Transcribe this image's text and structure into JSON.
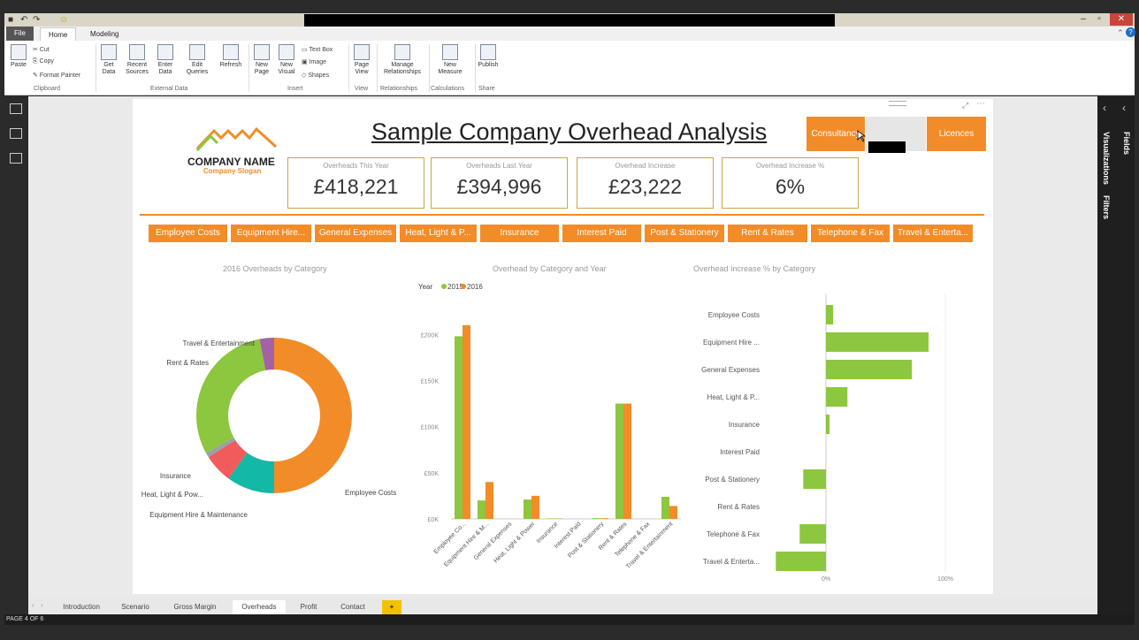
{
  "ribbon": {
    "tabs": [
      "File",
      "Home",
      "Modeling"
    ],
    "clipboard": {
      "paste": "Paste",
      "cut": "Cut",
      "copy": "Copy",
      "format_painter": "Format Painter",
      "group": "Clipboard"
    },
    "external": {
      "get_data": "Get Data",
      "recent": "Recent Sources",
      "enter": "Enter Data",
      "edit": "Edit Queries",
      "refresh": "Refresh",
      "group": "External Data"
    },
    "insert": {
      "new_page": "New Page",
      "new_visual": "New Visual",
      "text_box": "Text Box",
      "image": "Image",
      "shapes": "Shapes",
      "group": "Insert"
    },
    "view": {
      "page_view": "Page View",
      "group": "View"
    },
    "relationships": {
      "manage": "Manage Relationships",
      "group": "Relationships"
    },
    "calculations": {
      "new_measure": "New Measure",
      "group": "Calculations"
    },
    "share": {
      "publish": "Publish",
      "group": "Share"
    }
  },
  "report": {
    "title": "Sample Company Overhead Analysis",
    "company_name": "COMPANY NAME",
    "company_slogan": "Company Slogan",
    "top_slicers": [
      "Consultancy",
      "Licences"
    ],
    "kpis": [
      {
        "label": "Overheads This Year",
        "value": "£418,221"
      },
      {
        "label": "Overheads Last Year",
        "value": "£394,996"
      },
      {
        "label": "Overhead Increase",
        "value": "£23,222"
      },
      {
        "label": "Overhead Increase %",
        "value": "6%"
      }
    ],
    "category_slicers": [
      "Employee Costs",
      "Equipment Hire...",
      "General Expenses",
      "Heat, Light & P...",
      "Insurance",
      "Interest Paid",
      "Post & Stationery",
      "Rent & Rates",
      "Telephone & Fax",
      "Travel & Enterta..."
    ]
  },
  "chart_data": [
    {
      "type": "pie",
      "title": "2016 Overheads by Category",
      "categories": [
        "Employee Costs",
        "Equipment Hire & Maintenance",
        "Heat, Light & Pow...",
        "Insurance",
        "Rent & Rates",
        "Travel & Entertainment"
      ],
      "values": [
        50,
        10,
        6,
        1,
        30,
        3
      ],
      "colors": [
        "#f28c28",
        "#14b8a6",
        "#f15b5b",
        "#9aa0a6",
        "#8dc63f",
        "#a262a3"
      ]
    },
    {
      "type": "bar",
      "title": "Overhead by Category and Year",
      "legend_title": "Year",
      "categories": [
        "Employee Co...",
        "Equipment Hire & M...",
        "General Expenses",
        "Heat, Light & Power",
        "Insurance",
        "Interest Paid",
        "Post & Stationery",
        "Rent & Rates",
        "Telephone & Fax",
        "Travel & Entertainment"
      ],
      "series": [
        {
          "name": "2015",
          "color": "#8dc63f",
          "values": [
            198000,
            20000,
            0,
            21000,
            500,
            0,
            800,
            125000,
            0,
            24000
          ]
        },
        {
          "name": "2016",
          "color": "#f28c28",
          "values": [
            210000,
            40000,
            0,
            25000,
            500,
            0,
            800,
            125000,
            0,
            14000
          ]
        }
      ],
      "yticks": [
        "£0K",
        "£50K",
        "£100K",
        "£150K",
        "£200K"
      ],
      "ylim": [
        0,
        230000
      ]
    },
    {
      "type": "bar",
      "title": "Overhead Increase % by Category",
      "categories": [
        "Employee Costs",
        "Equipment Hire ...",
        "General Expenses",
        "Heat, Light & P...",
        "Insurance",
        "Interest Paid",
        "Post & Stationery",
        "Rent & Rates",
        "Telephone & Fax",
        "Travel & Enterta..."
      ],
      "values": [
        6,
        86,
        72,
        18,
        3,
        0,
        -19,
        0,
        -22,
        -42
      ],
      "xticks": [
        "0%",
        "100%"
      ],
      "color": "#8dc63f"
    }
  ],
  "page_tabs": [
    "Introduction",
    "Scenario",
    "Gross Margin",
    "Overheads",
    "Profit",
    "Contact"
  ],
  "add_page": "+",
  "status": "PAGE 4 OF 6",
  "right_panes": [
    "Visualizations",
    "Filters",
    "Fields"
  ]
}
